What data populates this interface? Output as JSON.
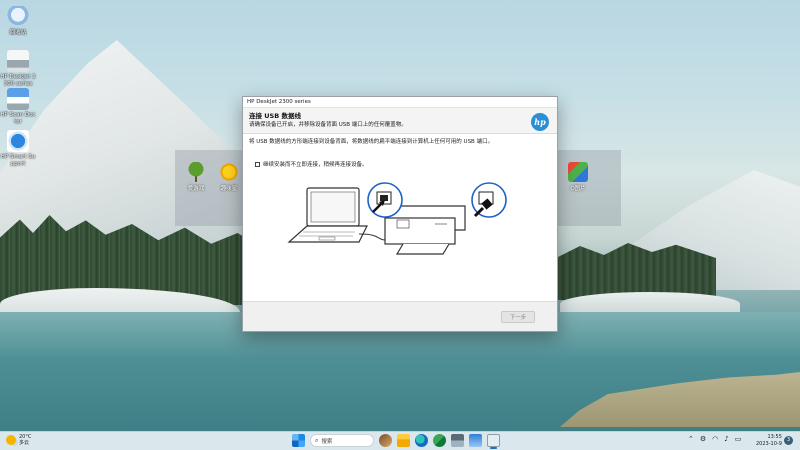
{
  "desktop": {
    "icons": [
      {
        "name": "recycle-bin",
        "label": "回收站"
      },
      {
        "name": "hp-deskjet",
        "label": "HP DeskJet 2300 series"
      },
      {
        "name": "hp-scan",
        "label": "HP Scan Doctor"
      },
      {
        "name": "hp-smart",
        "label": "HP Smart Support"
      }
    ],
    "overlay_icons": [
      {
        "label": "爱游戏"
      },
      {
        "label": "趣味星"
      },
      {
        "label": "Q图片"
      }
    ]
  },
  "dialog": {
    "window_title": "HP DeskJet 2300 series",
    "header_title": "连接 USB 数据线",
    "header_subtitle": "请确保设备已开启，并移除设备背面 USB 端口上的任何覆盖物。",
    "logo_text": "hp",
    "instruction": "将 USB 数据线的方形端连接到设备背面，将数据线的扁平端连接到计算机上任何可用的 USB 端口。",
    "checkbox_label": "继续安装而不立即连接，稍候再连接设备。",
    "checkbox_checked": false,
    "next_button": "下一步"
  },
  "taskbar": {
    "weather_temp": "20°C",
    "weather_desc": "多云",
    "search_label": "搜索",
    "tray_icons": [
      "chevron-up-icon",
      "network-icon",
      "wifi-icon",
      "speaker-icon",
      "battery-icon"
    ],
    "time": "13:55",
    "date": "2023-10-9",
    "notification_count": "3"
  }
}
